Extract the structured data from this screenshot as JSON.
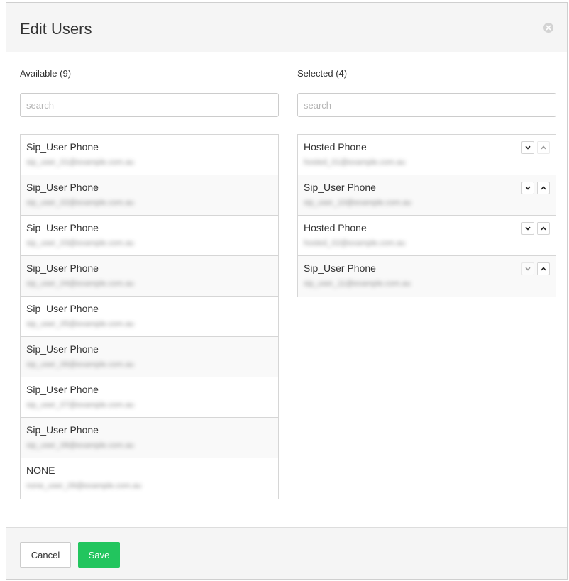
{
  "modal": {
    "title": "Edit Users",
    "close_icon": "close-circle-icon"
  },
  "available": {
    "label": "Available (9)",
    "search_placeholder": "search",
    "items": [
      {
        "name": "Sip_User Phone",
        "sub": "sip_user_01@example.com.au"
      },
      {
        "name": "Sip_User Phone",
        "sub": "sip_user_02@example.com.au"
      },
      {
        "name": "Sip_User Phone",
        "sub": "sip_user_03@example.com.au"
      },
      {
        "name": "Sip_User Phone",
        "sub": "sip_user_04@example.com.au"
      },
      {
        "name": "Sip_User Phone",
        "sub": "sip_user_05@example.com.au"
      },
      {
        "name": "Sip_User Phone",
        "sub": "sip_user_06@example.com.au"
      },
      {
        "name": "Sip_User Phone",
        "sub": "sip_user_07@example.com.au"
      },
      {
        "name": "Sip_User Phone",
        "sub": "sip_user_08@example.com.au"
      },
      {
        "name": "NONE",
        "sub": "none_user_09@example.com.au"
      }
    ]
  },
  "selected": {
    "label": "Selected (4)",
    "search_placeholder": "search",
    "items": [
      {
        "name": "Hosted Phone",
        "sub": "hosted_01@example.com.au"
      },
      {
        "name": "Sip_User Phone",
        "sub": "sip_user_10@example.com.au"
      },
      {
        "name": "Hosted Phone",
        "sub": "hosted_02@example.com.au"
      },
      {
        "name": "Sip_User Phone",
        "sub": "sip_user_11@example.com.au"
      }
    ],
    "move_down_icon": "chevron-down-icon",
    "move_up_icon": "chevron-up-icon"
  },
  "footer": {
    "cancel_label": "Cancel",
    "save_label": "Save"
  },
  "colors": {
    "save_button": "#22c55e",
    "header_bg": "#f5f5f5",
    "border": "#d6d6d6"
  }
}
